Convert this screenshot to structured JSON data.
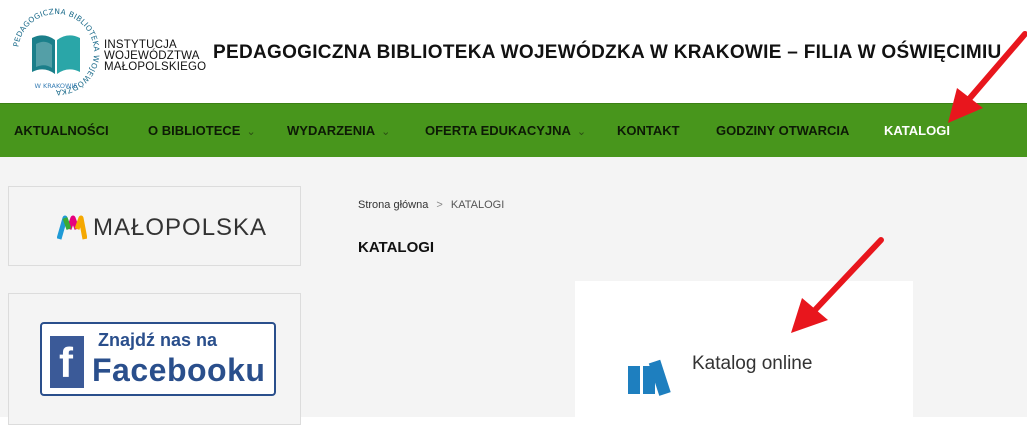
{
  "header": {
    "logo_ring_text": "PEDAGOGICZNA BIBLIOTEKA WOJEWÓDZKA",
    "logo_city_text": "W KRAKOWIE",
    "institution_lines": [
      "INSTYTUCJA",
      "WOJEWÓDZTWA",
      "MAŁOPOLSKIEGO"
    ],
    "site_title": "PEDAGOGICZNA BIBLIOTEKA WOJEWÓDZKA W KRAKOWIE – FILIA W OŚWIĘCIMIU"
  },
  "nav": {
    "items": [
      {
        "label": "AKTUALNOŚCI",
        "dropdown": false
      },
      {
        "label": "O BIBLIOTECE",
        "dropdown": true
      },
      {
        "label": "WYDARZENIA",
        "dropdown": true
      },
      {
        "label": "OFERTA EDUKACYJNA",
        "dropdown": true
      },
      {
        "label": "KONTAKT",
        "dropdown": false
      },
      {
        "label": "GODZINY OTWARCIA",
        "dropdown": false
      },
      {
        "label": "KATALOGI",
        "dropdown": false,
        "active": true
      }
    ],
    "chevron": "⌄"
  },
  "sidebar": {
    "malopolska_text": "MAŁOPOLSKA",
    "facebook_line1": "Znajdź nas na",
    "facebook_line2": "Facebooku",
    "facebook_f": "f"
  },
  "breadcrumb": {
    "home": "Strona główna",
    "separator": ">",
    "current": "KATALOGI"
  },
  "page_title": "KATALOGI",
  "katalog_card": {
    "label": "Katalog online",
    "icon": "books-icon"
  },
  "colors": {
    "nav_bg": "#48961c",
    "nav_active": "#ffffff",
    "arrow": "#e8161d",
    "katalog_icon": "#1e7fbf",
    "facebook_blue": "#2a4f8c"
  }
}
